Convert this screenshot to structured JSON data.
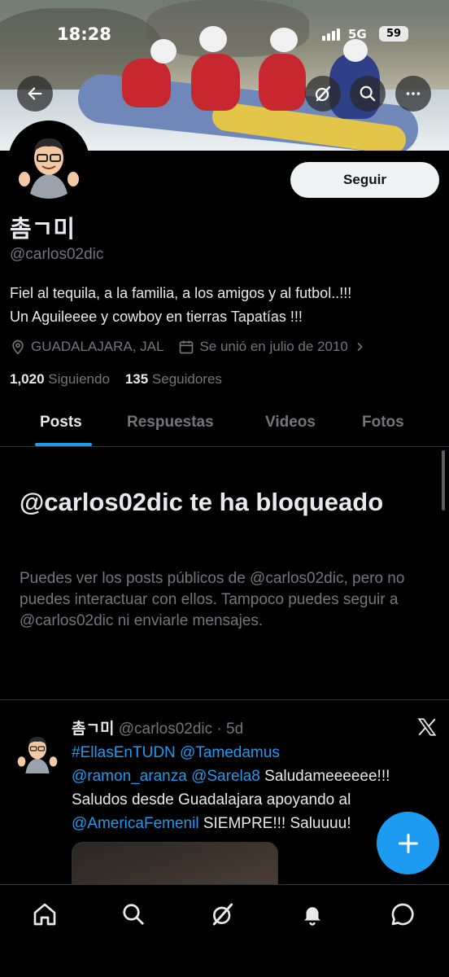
{
  "status_bar": {
    "time": "18:28",
    "network": "5G",
    "battery": "59"
  },
  "header": {
    "back_icon": "arrow-left-icon",
    "grok_icon": "grok-icon",
    "search_icon": "search-icon",
    "more_icon": "more-icon"
  },
  "profile": {
    "display_name": "촘ㄱ미",
    "handle": "@carlos02dic",
    "follow_label": "Seguir",
    "bio_line1": "Fiel al tequila, a la familia, a los amigos y al futbol..!!!",
    "bio_line2": "Un Aguileeee y cowboy en tierras Tapatías !!!",
    "location": "GUADALAJARA, JAL",
    "joined": "Se unió en julio de 2010",
    "following_count": "1,020",
    "following_label": "Siguiendo",
    "followers_count": "135",
    "followers_label": "Seguidores"
  },
  "tabs": [
    {
      "label": "Posts",
      "active": true
    },
    {
      "label": "Respuestas",
      "active": false
    },
    {
      "label": "Videos",
      "active": false
    },
    {
      "label": "Fotos",
      "active": false
    }
  ],
  "blocked": {
    "title": "@carlos02dic te ha bloqueado",
    "message": "Puedes ver los posts públicos de @carlos02dic, pero no puedes interactuar con ellos. Tampoco puedes seguir a @carlos02dic ni enviarle mensajes."
  },
  "post": {
    "author_name": "촘ㄱ미",
    "author_handle_time": "@carlos02dic · 5d",
    "hashtag": "#EllasEnTUDN",
    "mention1": "@Tamedamus",
    "mention2": "@ramon_aranza",
    "mention3": "@Sarela8",
    "text1": " Saludameeeeee!!!",
    "text2": "Saludos desde Guadalajara apoyando al",
    "mention4": "@AmericaFemenil",
    "text3": " SIEMPRE!!! Saluuuu!"
  },
  "colors": {
    "accent": "#1d9bf0",
    "secondary_text": "#71767b",
    "divider": "#2f3336"
  }
}
